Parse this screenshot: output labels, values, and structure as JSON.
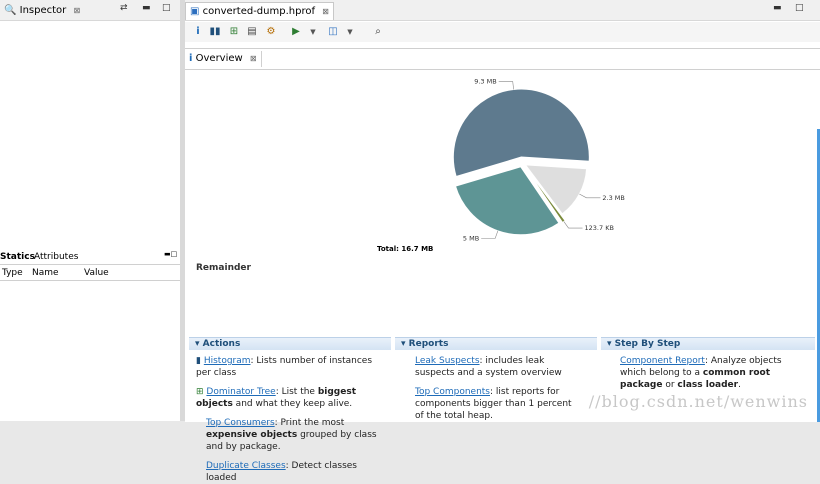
{
  "left_panel": {
    "tab_label": "Inspector",
    "tab_close": "⊠",
    "statics_tab": "Statics",
    "attributes_tab": "Attributes",
    "columns": [
      "Type",
      "Name",
      "Value"
    ]
  },
  "editor": {
    "tab_label": "converted-dump.hprof",
    "tab_close": "⊠",
    "overview_tab": "Overview",
    "overview_close": "⊠",
    "toolbar_icons": [
      "info-icon",
      "histogram-icon",
      "dominator-tree-icon",
      "oql-icon",
      "heap-dump-icon",
      "run-report-icon",
      "query-browser-icon",
      "search-icon"
    ],
    "colors": {
      "slice_large": "#5e7a8e",
      "slice_medium": "#5e9595",
      "slice_small": "#dedede",
      "slice_tiny": "#7a8a3a"
    }
  },
  "chart_data": {
    "type": "pie",
    "slices": [
      {
        "label": "9.3 MB",
        "value": 9.3
      },
      {
        "label": "2.3 MB",
        "value": 2.3
      },
      {
        "label": "123.7 KB",
        "value": 0.1237
      },
      {
        "label": "5 MB",
        "value": 5.0
      }
    ],
    "total_label": "Total: 16.7 MB"
  },
  "remainder_label": "Remainder",
  "sections": {
    "actions": {
      "title": "Actions",
      "items": [
        {
          "link": "Histogram",
          "text": ": Lists number of instances per class"
        },
        {
          "link": "Dominator Tree",
          "text": ": List the ",
          "bold": "biggest objects",
          "text2": " and what they keep alive."
        },
        {
          "link": "Top Consumers",
          "text": ": Print the most ",
          "bold": "expensive objects",
          "text2": " grouped by class and by package."
        },
        {
          "link": "Duplicate Classes",
          "text": ": Detect classes loaded"
        }
      ]
    },
    "reports": {
      "title": "Reports",
      "items": [
        {
          "link": "Leak Suspects",
          "text": ": includes leak suspects and a system overview"
        },
        {
          "link": "Top Components",
          "text": ": list reports for components bigger than 1 percent of the total heap."
        }
      ]
    },
    "step_by_step": {
      "title": "Step By Step",
      "items": [
        {
          "link": "Component Report",
          "text": ": Analyze objects which belong to a ",
          "bold": "common root package",
          "text2": " or ",
          "bold2": "class loader",
          "text3": "."
        }
      ]
    }
  },
  "watermark": "//blog.csdn.net/wenwins"
}
